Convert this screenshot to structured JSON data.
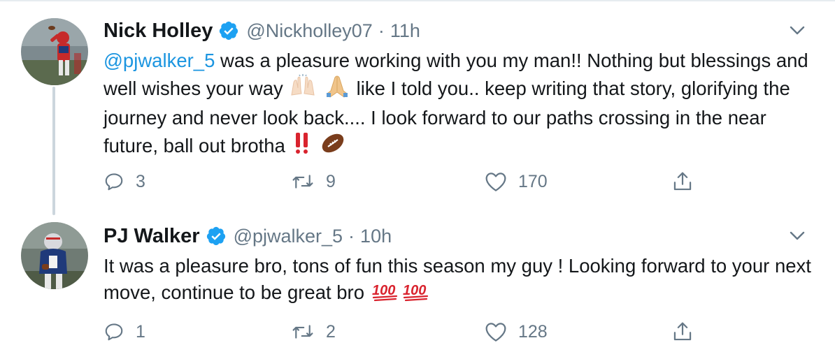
{
  "tweets": [
    {
      "author_name": "Nick Holley",
      "handle": "@Nickholley07",
      "separator": "·",
      "time": "11h",
      "mention": "@pjwalker_5",
      "text_part1": " was a pleasure working with you my man!! Nothing but blessings and well wishes your way",
      "text_part2": " like I told you.. keep writing that story, glorifying the journey and never look back.... I look forward to our paths crossing in the near future, ball out brotha",
      "emojis": [
        "raising-hands-emoji",
        "folded-hands-emoji",
        "double-exclamation-emoji",
        "american-football-emoji"
      ],
      "replies": "3",
      "retweets": "9",
      "likes": "170"
    },
    {
      "author_name": "PJ Walker",
      "handle": "@pjwalker_5",
      "separator": "·",
      "time": "10h",
      "text": "It was a pleasure bro, tons of fun this season my guy ! Looking forward to your next move, continue to be great bro",
      "emojis": [
        "hundred-points-emoji",
        "hundred-points-emoji"
      ],
      "replies": "1",
      "retweets": "2",
      "likes": "128"
    }
  ],
  "colors": {
    "link": "#1b95e0",
    "verified": "#1da1f2",
    "secondary_text": "#657786",
    "thread_line": "#ccd6dd"
  },
  "icons": {
    "reply": "reply-icon",
    "retweet": "retweet-icon",
    "like": "like-icon",
    "share": "share-icon",
    "menu": "chevron-down-icon",
    "verified": "verified-badge-icon"
  }
}
